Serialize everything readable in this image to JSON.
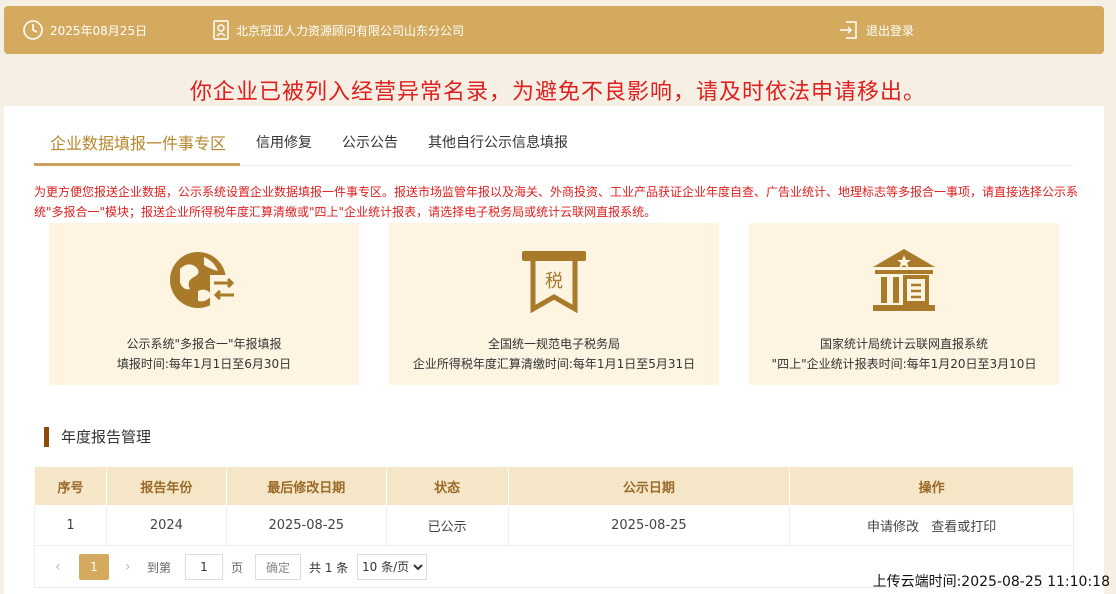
{
  "header": {
    "date": "2025年08月25日",
    "company": "北京冠亚人力资源顾问有限公司山东分公司",
    "logout_label": "退出登录"
  },
  "warning": "你企业已被列入经营异常名录，为避免不良影响，请及时依法申请移出。",
  "tabs": [
    {
      "label": "企业数据填报一件事专区",
      "active": true
    },
    {
      "label": "信用修复",
      "active": false
    },
    {
      "label": "公示公告",
      "active": false
    },
    {
      "label": "其他自行公示信息填报",
      "active": false
    }
  ],
  "notice": "为更方便您报送企业数据，公示系统设置企业数据填报一件事专区。报送市场监管年报以及海关、外商投资、工业产品获证企业年度自查、广告业统计、地理标志等多报合一事项，请直接选择公示系统\"多报合一\"模块；报送企业所得税年度汇算清缴或\"四上\"企业统计报表，请选择电子税务局或统计云联网直报系统。",
  "cards": [
    {
      "icon": "globe-exchange-icon",
      "title": "公示系统\"多报合一\"年报填报",
      "period": "填报时间:每年1月1日至6月30日"
    },
    {
      "icon": "tax-icon",
      "title": "全国统一规范电子税务局",
      "period": "企业所得税年度汇算清缴时间:每年1月1日至5月31日"
    },
    {
      "icon": "statistics-bureau-icon",
      "title": "国家统计局统计云联网直报系统",
      "period": "\"四上\"企业统计报表时间:每年1月20日至3月10日"
    }
  ],
  "tax_char": "税",
  "section_title": "年度报告管理",
  "table": {
    "headers": [
      "序号",
      "报告年份",
      "最后修改日期",
      "状态",
      "公示日期",
      "操作"
    ],
    "rows": [
      {
        "no": "1",
        "year": "2024",
        "modified": "2025-08-25",
        "status": "已公示",
        "publish_date": "2025-08-25",
        "op_edit": "申请修改",
        "op_view": "查看或打印"
      }
    ]
  },
  "pager": {
    "current_page": "1",
    "goto_label": "到第",
    "goto_value": "1",
    "page_unit": "页",
    "confirm_label": "确定",
    "total_label": "共 1 条",
    "page_size": "10 条/页"
  },
  "upload_time": "上传云端时间:2025-08-25 11:10:18",
  "colors": {
    "accent": "#d4aa5e",
    "warning": "#e02020",
    "icon_brown": "#a87a2a"
  }
}
